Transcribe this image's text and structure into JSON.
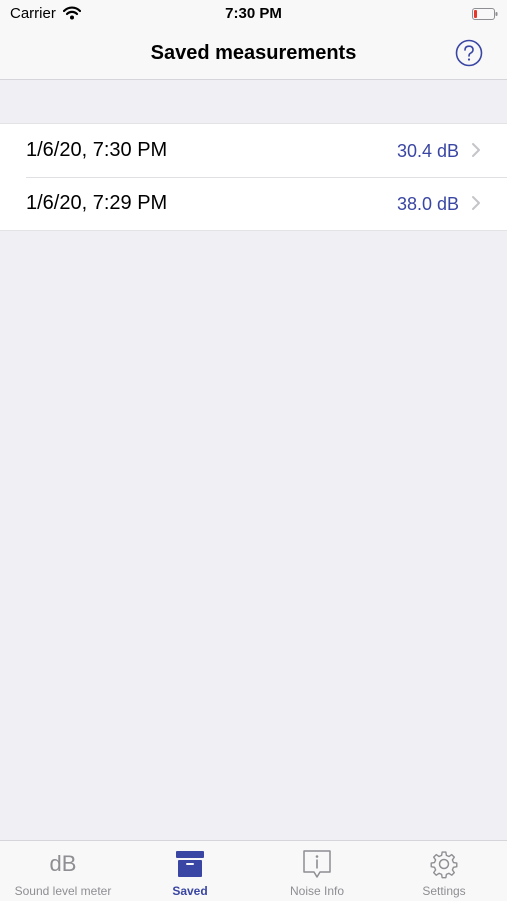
{
  "status_bar": {
    "carrier": "Carrier",
    "time": "7:30 PM"
  },
  "nav": {
    "title": "Saved measurements",
    "help_icon": "question-circle-icon"
  },
  "measurements": [
    {
      "date": "1/6/20, 7:30 PM",
      "value": "30.4 dB"
    },
    {
      "date": "1/6/20, 7:29 PM",
      "value": "38.0 dB"
    }
  ],
  "tab_bar": {
    "tabs": [
      {
        "label": "Sound level meter",
        "icon_text": "dB",
        "icon": "db-text-icon",
        "active": false
      },
      {
        "label": "Saved",
        "icon": "archive-box-icon",
        "active": true
      },
      {
        "label": "Noise Info",
        "icon": "info-bubble-icon",
        "active": false
      },
      {
        "label": "Settings",
        "icon": "gear-icon",
        "active": false
      }
    ]
  },
  "colors": {
    "accent": "#3a46a3",
    "background": "#efeff4",
    "inactive": "#8e8e93"
  }
}
